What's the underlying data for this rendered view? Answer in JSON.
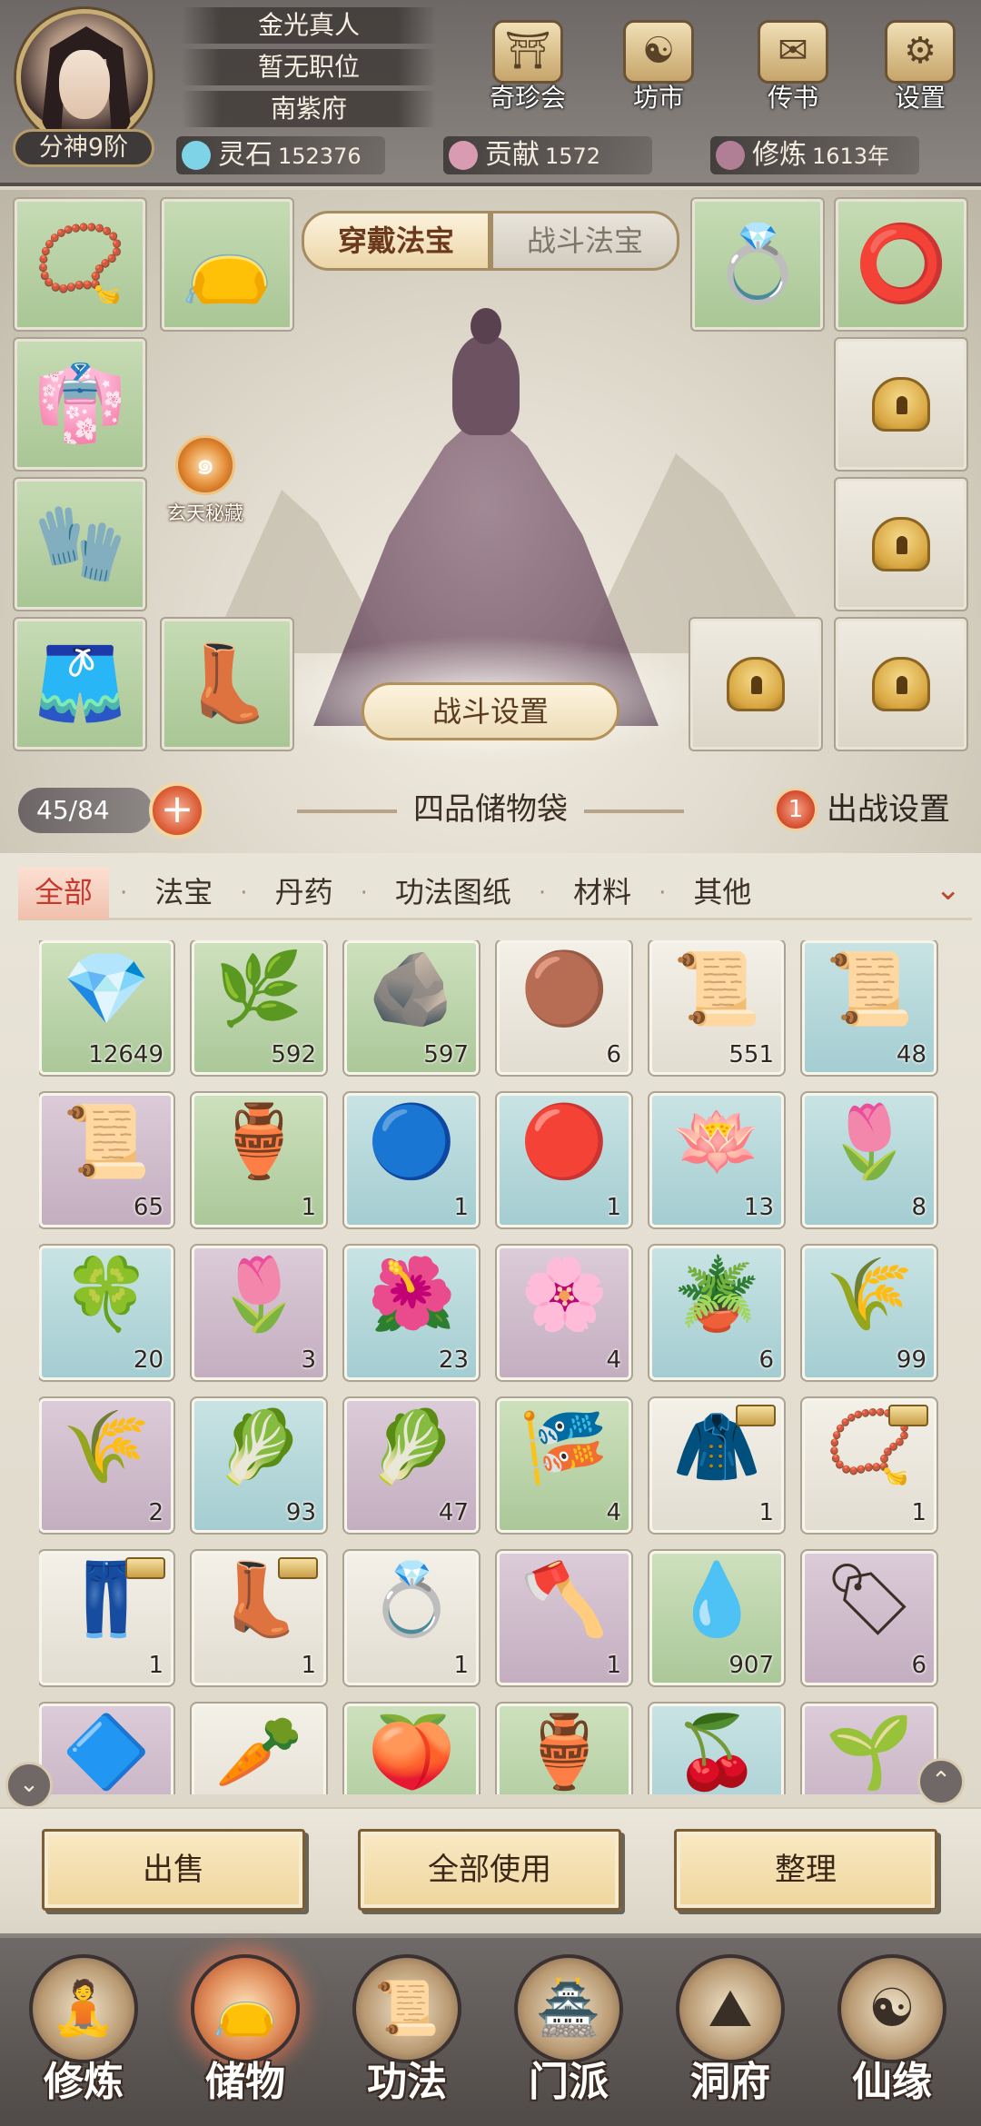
{
  "header": {
    "player_name": "金光真人",
    "position": "暂无职位",
    "residence": "南紫府",
    "realm": "分神9阶",
    "buttons": [
      {
        "label": "奇珍会",
        "icon": "treasure-hall-icon",
        "glyph": "⛩"
      },
      {
        "label": "坊市",
        "icon": "market-icon",
        "glyph": "☯"
      },
      {
        "label": "传书",
        "icon": "letter-icon",
        "glyph": "✉"
      },
      {
        "label": "设置",
        "icon": "gear-icon",
        "glyph": "⚙"
      }
    ],
    "resources": [
      {
        "name": "灵石",
        "value": "152376",
        "color": "#7fd3e6"
      },
      {
        "name": "贡献",
        "value": "1572",
        "color": "#d99bb1"
      },
      {
        "name": "修炼",
        "value": "1613年",
        "color": "#b07f96"
      }
    ]
  },
  "equipment": {
    "tabs": [
      "穿戴法宝",
      "战斗法宝"
    ],
    "active_tab": "穿戴法宝",
    "secret_label": "玄天秘藏",
    "battle_settings": "战斗设置",
    "left_slots": [
      {
        "icon": "necklace-icon",
        "glyph": "📿"
      },
      {
        "icon": "pouch-icon",
        "glyph": "👝"
      },
      {
        "icon": "robe-icon",
        "glyph": "👘"
      },
      {
        "icon": "glove-icon",
        "glyph": "🧤"
      },
      {
        "icon": "pants-icon",
        "glyph": "🩳"
      },
      {
        "icon": "boots-icon",
        "glyph": "👢"
      }
    ],
    "right_slots": [
      {
        "icon": "ring-icon",
        "glyph": "💍"
      },
      {
        "icon": "ring-icon",
        "glyph": "⭕"
      }
    ]
  },
  "bag": {
    "capacity": "45/84",
    "title": "四品储物袋",
    "deploy_count": "1",
    "deploy_label": "出战设置"
  },
  "categories": [
    "全部",
    "法宝",
    "丹药",
    "功法图纸",
    "材料",
    "其他"
  ],
  "active_category": "全部",
  "items": [
    {
      "icon": "spirit-stone-icon",
      "glyph": "💎",
      "count": "12649",
      "bg": "g"
    },
    {
      "icon": "herb-icon",
      "glyph": "🌿",
      "count": "592",
      "bg": "g"
    },
    {
      "icon": "ore-icon",
      "glyph": "🪨",
      "count": "597",
      "bg": "g"
    },
    {
      "icon": "pearl-icon",
      "glyph": "🟤",
      "count": "6",
      "bg": "w"
    },
    {
      "icon": "scroll-icon",
      "glyph": "📜",
      "count": "551",
      "bg": "w"
    },
    {
      "icon": "scroll-icon",
      "glyph": "📜",
      "count": "48",
      "bg": "b"
    },
    {
      "icon": "scroll-icon",
      "glyph": "📜",
      "count": "65",
      "bg": "p"
    },
    {
      "icon": "vase-icon",
      "glyph": "🏺",
      "count": "1",
      "bg": "g"
    },
    {
      "icon": "blue-orb-icon",
      "glyph": "🔵",
      "count": "1",
      "bg": "b"
    },
    {
      "icon": "red-orb-icon",
      "glyph": "🔴",
      "count": "1",
      "bg": "b"
    },
    {
      "icon": "lotus-leaf-icon",
      "glyph": "🪷",
      "count": "13",
      "bg": "b"
    },
    {
      "icon": "blue-flower-icon",
      "glyph": "🌷",
      "count": "8",
      "bg": "b"
    },
    {
      "icon": "lotus-leaf-icon",
      "glyph": "🍀",
      "count": "20",
      "bg": "b"
    },
    {
      "icon": "blue-flower-icon",
      "glyph": "🌷",
      "count": "3",
      "bg": "p"
    },
    {
      "icon": "purple-plant-icon",
      "glyph": "🌺",
      "count": "23",
      "bg": "b"
    },
    {
      "icon": "purple-plant-icon",
      "glyph": "🌸",
      "count": "4",
      "bg": "p"
    },
    {
      "icon": "blue-plant-icon",
      "glyph": "🪴",
      "count": "6",
      "bg": "b"
    },
    {
      "icon": "grass-icon",
      "glyph": "🌾",
      "count": "99",
      "bg": "b"
    },
    {
      "icon": "grass-icon",
      "glyph": "🌾",
      "count": "2",
      "bg": "p"
    },
    {
      "icon": "leafy-plant-icon",
      "glyph": "🥬",
      "count": "93",
      "bg": "b"
    },
    {
      "icon": "leafy-plant-icon",
      "glyph": "🥬",
      "count": "47",
      "bg": "p"
    },
    {
      "icon": "star-scroll-icon",
      "glyph": "🎏",
      "count": "4",
      "bg": "g"
    },
    {
      "icon": "cloak-icon",
      "glyph": "🧥",
      "count": "1",
      "bg": "w",
      "tag": true
    },
    {
      "icon": "necklace-icon",
      "glyph": "📿",
      "count": "1",
      "bg": "w",
      "tag": true
    },
    {
      "icon": "pants-icon",
      "glyph": "👖",
      "count": "1",
      "bg": "w",
      "tag": true
    },
    {
      "icon": "boots-icon",
      "glyph": "👢",
      "count": "1",
      "bg": "w",
      "tag": true
    },
    {
      "icon": "ring-icon",
      "glyph": "💍",
      "count": "1",
      "bg": "w"
    },
    {
      "icon": "axe-icon",
      "glyph": "🪓",
      "count": "1",
      "bg": "p"
    },
    {
      "icon": "water-drop-icon",
      "glyph": "💧",
      "count": "907",
      "bg": "g"
    },
    {
      "icon": "token-icon",
      "glyph": "🏷",
      "count": "6",
      "bg": "p"
    },
    {
      "icon": "crystal-icon",
      "glyph": "🔷",
      "count": "",
      "bg": "p"
    },
    {
      "icon": "root-icon",
      "glyph": "🥕",
      "count": "",
      "bg": "w"
    },
    {
      "icon": "fruit-plant-icon",
      "glyph": "🍑",
      "count": "",
      "bg": "g"
    },
    {
      "icon": "gourd-icon",
      "glyph": "🏺",
      "count": "",
      "bg": "g"
    },
    {
      "icon": "fruit-plant-icon",
      "glyph": "🍒",
      "count": "",
      "bg": "b"
    },
    {
      "icon": "fruit-plant-icon",
      "glyph": "🌱",
      "count": "",
      "bg": "p"
    }
  ],
  "actions": {
    "sell": "出售",
    "use_all": "全部使用",
    "sort": "整理"
  },
  "nav": [
    {
      "label": "修炼",
      "icon": "cultivate-icon",
      "glyph": "🧘"
    },
    {
      "label": "储物",
      "icon": "storage-icon",
      "glyph": "👝"
    },
    {
      "label": "功法",
      "icon": "technique-icon",
      "glyph": "📜"
    },
    {
      "label": "门派",
      "icon": "sect-icon",
      "glyph": "🏯"
    },
    {
      "label": "洞府",
      "icon": "cave-icon",
      "glyph": "⛰"
    },
    {
      "label": "仙缘",
      "icon": "fate-icon",
      "glyph": "☯"
    }
  ],
  "active_nav": "储物"
}
